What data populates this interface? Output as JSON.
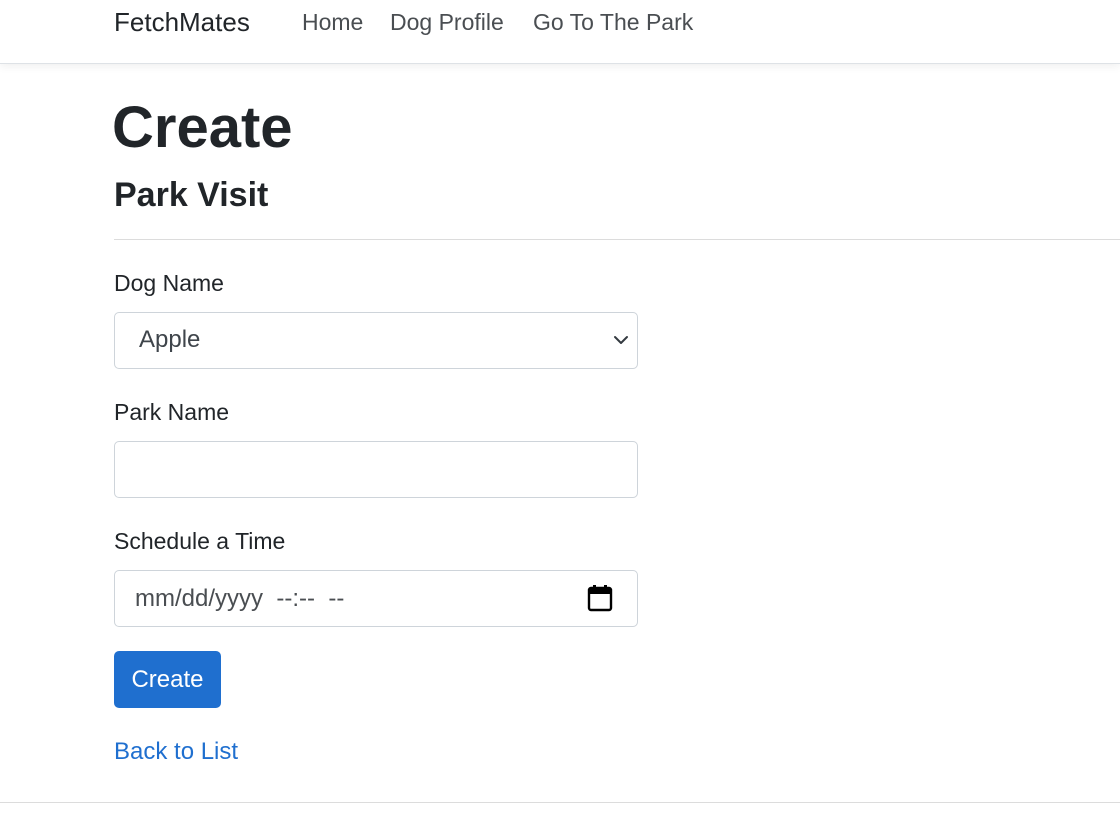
{
  "navbar": {
    "brand": "FetchMates",
    "links": [
      {
        "label": "Home"
      },
      {
        "label": "Dog Profile"
      },
      {
        "label": "Go To The Park"
      }
    ]
  },
  "page": {
    "title": "Create",
    "subtitle": "Park Visit"
  },
  "form": {
    "dog_name": {
      "label": "Dog Name",
      "selected": "Apple",
      "icon": "chevron-down-icon"
    },
    "park_name": {
      "label": "Park Name",
      "value": ""
    },
    "schedule_time": {
      "label": "Schedule a Time",
      "placeholder": "mm/dd/yyyy  --:--  --",
      "icon": "calendar-icon"
    },
    "submit_label": "Create"
  },
  "links": {
    "back_to_list": "Back to List"
  },
  "colors": {
    "primary": "#1f6fcf",
    "text": "#212529",
    "border": "#ced4da"
  }
}
